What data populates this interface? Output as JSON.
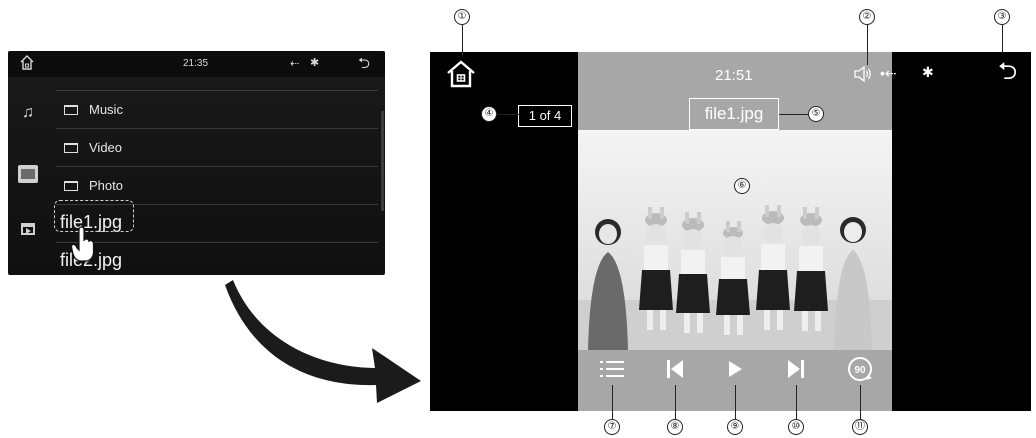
{
  "left_screen": {
    "time": "21:35",
    "folders": [
      "Music",
      "Video",
      "Photo"
    ],
    "files": [
      "file1.jpg",
      "file2.jpg"
    ]
  },
  "right_screen": {
    "time": "21:51",
    "page_counter": "1 of 4",
    "file_title": "file1.jpg"
  },
  "callouts": [
    "①",
    "②",
    "③",
    "④",
    "⑤",
    "⑥",
    "⑦",
    "⑧",
    "⑨",
    "⑩",
    "⑪"
  ],
  "colors": {
    "center_panel": "#a7a7a7",
    "screen_bg": "#000000"
  },
  "icons": {
    "left_status": [
      "home-icon",
      "usb-icon",
      "bluetooth-icon",
      "back-icon"
    ],
    "left_sidebar": [
      "music-icon",
      "photo-icon",
      "video-icon"
    ],
    "right_status": [
      "home-icon",
      "speaker-icon",
      "usb-icon",
      "bluetooth-icon",
      "back-icon"
    ],
    "controls": [
      "list-icon",
      "previous-icon",
      "play-icon",
      "next-icon",
      "rotate-90-icon"
    ]
  }
}
